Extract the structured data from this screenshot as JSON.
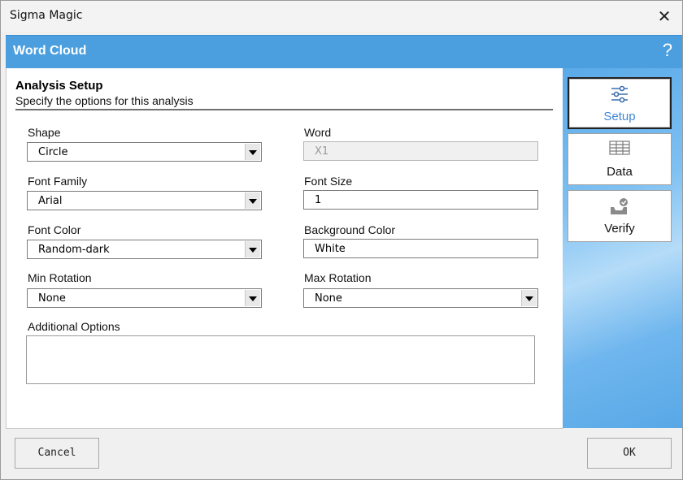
{
  "window": {
    "title": "Sigma Magic",
    "close_icon": "close-icon"
  },
  "header": {
    "title": "Word Cloud",
    "help_label": "?"
  },
  "section": {
    "title": "Analysis Setup",
    "subtitle": "Specify the options for this analysis"
  },
  "fields": {
    "shape": {
      "label": "Shape",
      "value": "Circle"
    },
    "word": {
      "label": "Word",
      "value": "X1"
    },
    "font_family": {
      "label": "Font Family",
      "value": "Arial"
    },
    "font_size": {
      "label": "Font Size",
      "value": "1"
    },
    "font_color": {
      "label": "Font Color",
      "value": "Random-dark"
    },
    "background_color": {
      "label": "Background Color",
      "value": "White"
    },
    "min_rotation": {
      "label": "Min Rotation",
      "value": "None"
    },
    "max_rotation": {
      "label": "Max Rotation",
      "value": "None"
    },
    "additional_options": {
      "label": "Additional Options",
      "value": ""
    }
  },
  "nav": [
    {
      "label": "Setup",
      "icon": "sliders-icon",
      "active": true
    },
    {
      "label": "Data",
      "icon": "table-icon",
      "active": false
    },
    {
      "label": "Verify",
      "icon": "inbox-check-icon",
      "active": false
    }
  ],
  "buttons": {
    "cancel": "Cancel",
    "ok": "OK"
  },
  "colors": {
    "header_bg": "#4b9fdf",
    "active_nav_text": "#3f86d6"
  }
}
